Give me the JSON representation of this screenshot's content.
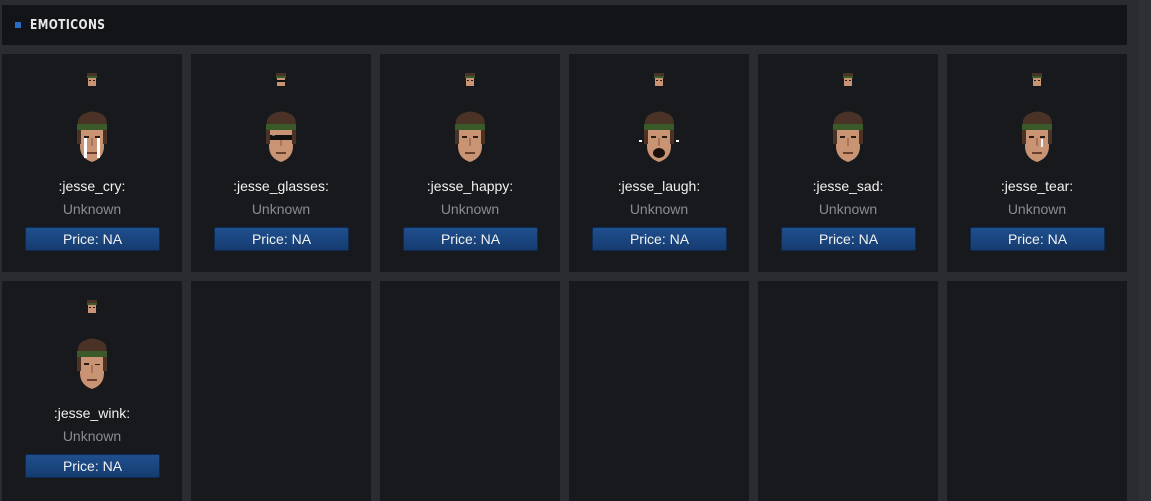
{
  "header": {
    "title": "EMOTICONS"
  },
  "colors": {
    "accent": "#2a6bc4",
    "price_button": "#1a4582",
    "card_bg": "#18191d"
  },
  "emoticons": [
    {
      "name": ":jesse_cry:",
      "rarity": "Unknown",
      "price": "Price: NA",
      "icon": "jesse-cry-icon"
    },
    {
      "name": ":jesse_glasses:",
      "rarity": "Unknown",
      "price": "Price: NA",
      "icon": "jesse-glasses-icon"
    },
    {
      "name": ":jesse_happy:",
      "rarity": "Unknown",
      "price": "Price: NA",
      "icon": "jesse-happy-icon"
    },
    {
      "name": ":jesse_laugh:",
      "rarity": "Unknown",
      "price": "Price: NA",
      "icon": "jesse-laugh-icon"
    },
    {
      "name": ":jesse_sad:",
      "rarity": "Unknown",
      "price": "Price: NA",
      "icon": "jesse-sad-icon"
    },
    {
      "name": ":jesse_tear:",
      "rarity": "Unknown",
      "price": "Price: NA",
      "icon": "jesse-tear-icon"
    },
    {
      "name": ":jesse_wink:",
      "rarity": "Unknown",
      "price": "Price: NA",
      "icon": "jesse-wink-icon"
    }
  ]
}
